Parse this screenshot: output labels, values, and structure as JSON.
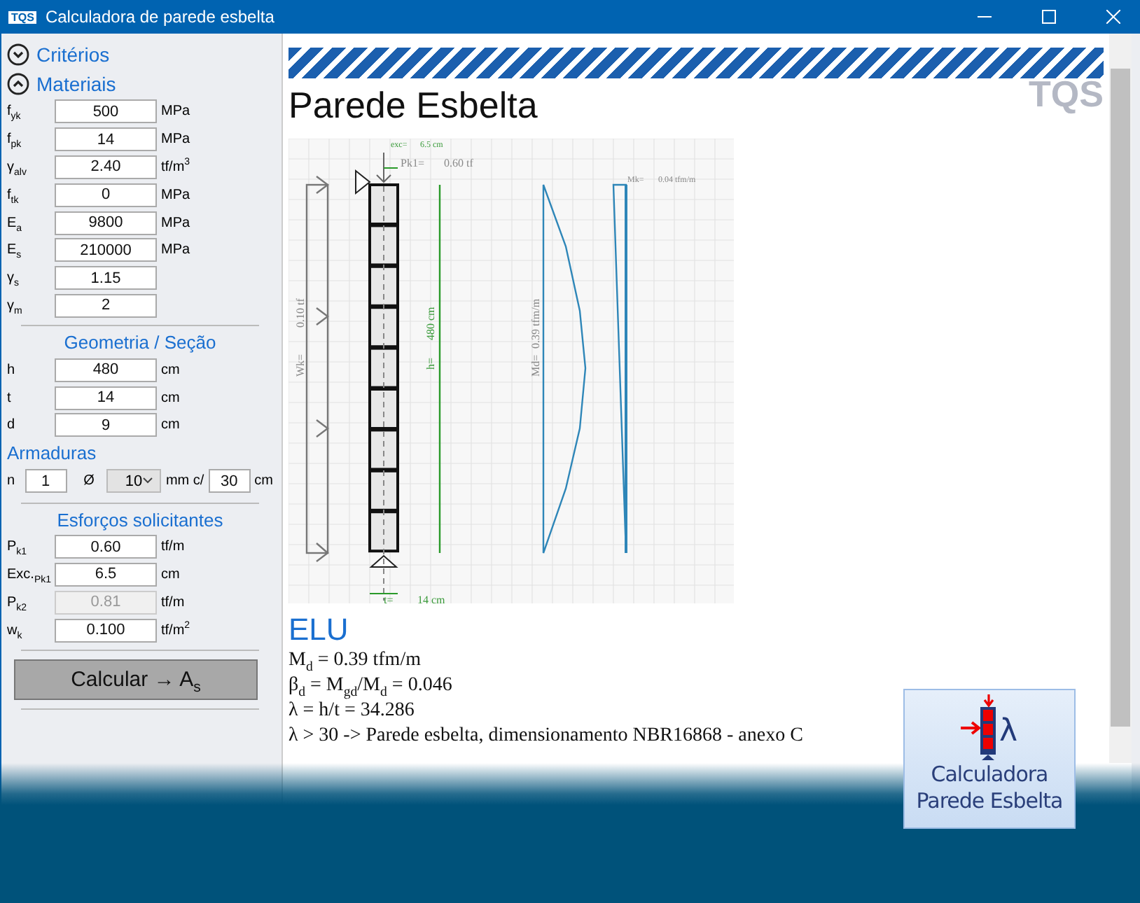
{
  "window": {
    "logo": "TQS",
    "title": "Calculadora de parede esbelta"
  },
  "criteria": {
    "title": "Critérios",
    "expanded": false
  },
  "materials": {
    "title": "Materiais",
    "expanded": true,
    "fields": [
      {
        "label": "f$_{yk}$",
        "value": "500",
        "unit": "MPa",
        "disabled": false
      },
      {
        "label": "f$_{pk}$",
        "value": "14",
        "unit": "MPa",
        "disabled": false
      },
      {
        "label": "γ$_{alv}$",
        "value": "2.40",
        "unit": "tf/m$^{3}$",
        "disabled": false
      },
      {
        "label": "f$_{tk}$",
        "value": "0",
        "unit": "MPa",
        "disabled": false
      },
      {
        "label": "E$_{a}$",
        "value": "9800",
        "unit": "MPa",
        "disabled": false
      },
      {
        "label": "E$_{s}$",
        "value": "210000",
        "unit": "MPa",
        "disabled": false
      },
      {
        "label": "γ$_{s}$",
        "value": "1.15",
        "disabled": false
      },
      {
        "label": "γ$_{m}$",
        "value": "2",
        "disabled": false
      }
    ]
  },
  "geometry": {
    "title": "Geometria / Seção",
    "fields": [
      {
        "label": "h",
        "value": "480",
        "unit": "cm",
        "disabled": false
      },
      {
        "label": "t",
        "value": "14",
        "unit": "cm",
        "disabled": false
      },
      {
        "label": "d",
        "value": "9",
        "unit": "cm",
        "disabled": false
      }
    ]
  },
  "reinforcement": {
    "title": "Armaduras",
    "n_label": "n",
    "n": "1",
    "diameter_label": "Ø",
    "diameter": "10",
    "diameter_unit": "mm c/",
    "spacing": "30",
    "spacing_unit": "cm"
  },
  "loads": {
    "title": "Esforços solicitantes",
    "fields": [
      {
        "label": "P$_{k1}$",
        "value": "0.60",
        "unit": "tf/m",
        "disabled": false
      },
      {
        "label": "Exc.$_{Pk1}$",
        "value": "6.5",
        "unit": "cm",
        "disabled": false
      },
      {
        "label": "P$_{k2}$",
        "value": "0.81",
        "unit": "tf/m",
        "disabled": true
      },
      {
        "label": "w$_{k}$",
        "value": "0.100",
        "unit": "tf/m$^{2}$",
        "disabled": false
      }
    ]
  },
  "calculate_button": "Calcular → A$_{s}$",
  "report": {
    "watermark": "TQS",
    "title": "Parede Esbelta",
    "diagram": {
      "exc_label": "exc=",
      "exc_value": "6.5 cm",
      "pk1_label": "Pk1=",
      "pk1_value": "0.60 tf",
      "mk_label": "Mk=",
      "mk_value": "0.04 tfm/m",
      "wk_label": "Wk=",
      "wk_value": "0.10 tf",
      "h_label": "h=",
      "h_value": "480 cm",
      "md_label": "Md=",
      "md_value": "0.39 tfm/m",
      "t_label": "t=",
      "t_value": "14 cm"
    },
    "section_title": "ELU",
    "lines": [
      "M$_{d}$ = 0.39 tfm/m",
      "β$_{d}$ = M$_{gd}$/M$_{d}$ = 0.046",
      "λ = h/t = 34.286",
      "λ > 30 -> Parede esbelta, dimensionamento NBR16868 - anexo C"
    ]
  },
  "promo_button": {
    "symbol": "λ",
    "lines": [
      "Calculadora",
      "Parede Esbelta"
    ]
  }
}
